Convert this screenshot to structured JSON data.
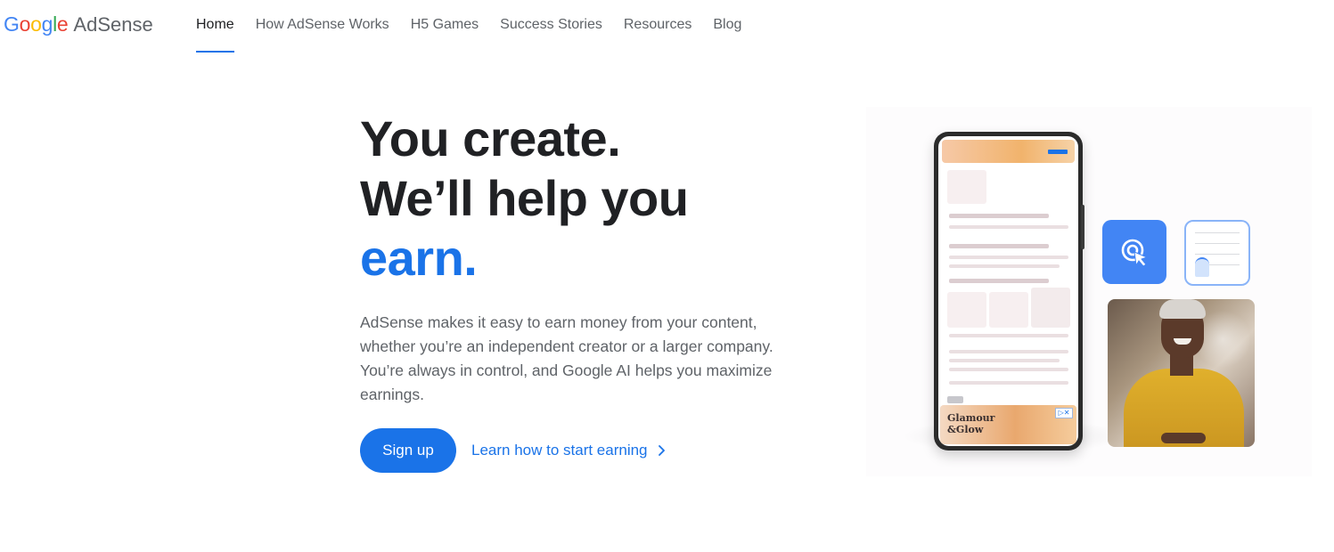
{
  "header": {
    "logo": {
      "brand_letters": [
        "G",
        "o",
        "o",
        "g",
        "l",
        "e"
      ],
      "brand_colors": [
        "#4285F4",
        "#EA4335",
        "#FBBC05",
        "#4285F4",
        "#34A853",
        "#EA4335"
      ],
      "product": "AdSense"
    },
    "nav": [
      {
        "label": "Home",
        "active": true
      },
      {
        "label": "How AdSense Works",
        "active": false
      },
      {
        "label": "H5 Games",
        "active": false
      },
      {
        "label": "Success Stories",
        "active": false
      },
      {
        "label": "Resources",
        "active": false
      },
      {
        "label": "Blog",
        "active": false
      }
    ]
  },
  "hero": {
    "headline_line1": "You create.",
    "headline_line2": "We’ll help you",
    "headline_accent": "earn.",
    "description": "AdSense makes it easy to earn money from your content, whether you’re an independent creator or a larger company. You’re always in control, and Google AI helps you maximize earnings.",
    "signup_label": "Sign up",
    "learn_label": "Learn how to start earning",
    "learn_icon": "chevron-right-icon"
  },
  "illustration": {
    "ad_text": "Glamour & Glow",
    "ad_line1": "Glamour",
    "ad_line2": "&Glow",
    "ad_choices": "▷✕",
    "click_icon": "cursor-click-icon",
    "photo": "smiling-woman-photo"
  },
  "colors": {
    "accent": "#1a73e8",
    "text": "#202124",
    "muted": "#5f6368",
    "tile_blue": "#4285f4"
  }
}
